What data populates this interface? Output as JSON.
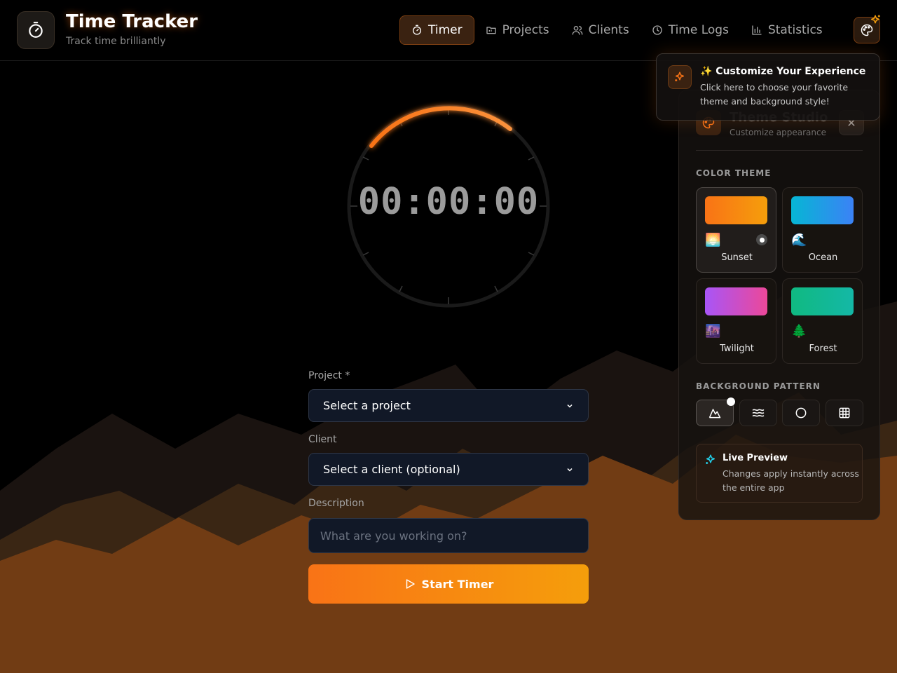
{
  "header": {
    "title": "Time Tracker",
    "subtitle": "Track time brilliantly",
    "logo_icon": "stopwatch-icon"
  },
  "nav": {
    "items": [
      {
        "label": "Timer",
        "icon": "stopwatch-icon",
        "active": true
      },
      {
        "label": "Projects",
        "icon": "folder-icon",
        "active": false
      },
      {
        "label": "Clients",
        "icon": "users-icon",
        "active": false
      },
      {
        "label": "Time Logs",
        "icon": "clock-icon",
        "active": false
      },
      {
        "label": "Statistics",
        "icon": "bar-chart-icon",
        "active": false
      }
    ],
    "theme_button_icon": "palette-icon"
  },
  "timer": {
    "display": "00:00:00"
  },
  "form": {
    "project_label": "Project *",
    "project_value": "Select a project",
    "client_label": "Client",
    "client_value": "Select a client (optional)",
    "description_label": "Description",
    "description_placeholder": "What are you working on?",
    "start_label": "Start Timer"
  },
  "tooltip": {
    "title": "✨ Customize Your Experience",
    "text": "Click here to choose your favorite theme and background style!"
  },
  "theme_studio": {
    "title": "Theme Studio",
    "subtitle": "Customize appearance",
    "color_theme_label": "COLOR THEME",
    "themes": [
      {
        "name": "Sunset",
        "emoji": "🌅",
        "from": "#f97316",
        "to": "#f59e0b",
        "selected": true
      },
      {
        "name": "Ocean",
        "emoji": "🌊",
        "from": "#06b6d4",
        "to": "#3b82f6",
        "selected": false
      },
      {
        "name": "Twilight",
        "emoji": "🌆",
        "from": "#a855f7",
        "to": "#ec4899",
        "selected": false
      },
      {
        "name": "Forest",
        "emoji": "🌲",
        "from": "#10b981",
        "to": "#14b8a6",
        "selected": false
      }
    ],
    "background_pattern_label": "BACKGROUND PATTERN",
    "patterns": [
      {
        "icon": "mountain-icon",
        "selected": true
      },
      {
        "icon": "waves-icon",
        "selected": false
      },
      {
        "icon": "circle-icon",
        "selected": false
      },
      {
        "icon": "grid-icon",
        "selected": false
      }
    ],
    "live_preview_title": "Live Preview",
    "live_preview_text": "Changes apply instantly across the entire app"
  },
  "colors": {
    "accent": "#f97316",
    "accent_secondary": "#f59e0b",
    "input_bg": "#111827",
    "mountain_back": "#3a2614",
    "mountain_front": "#713c14"
  }
}
